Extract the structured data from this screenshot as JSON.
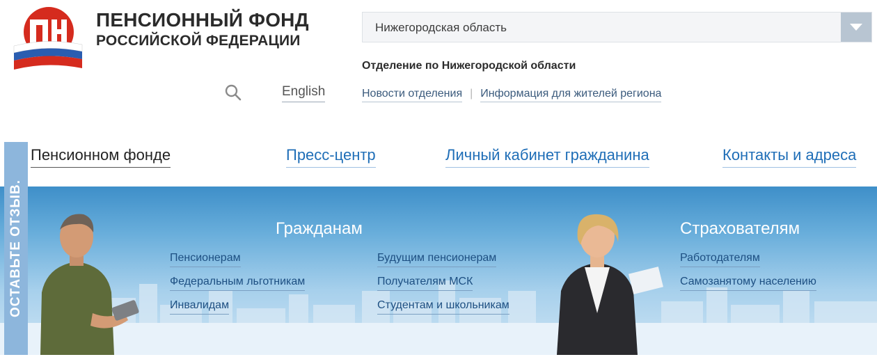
{
  "header": {
    "brand_line1": "ПЕНСИОННЫЙ ФОНД",
    "brand_line2": "РОССИЙСКОЙ ФЕДЕРАЦИИ",
    "region": "Нижегородская область",
    "office": "Отделение по Нижегородской области",
    "lang": "English",
    "sublinks": [
      "Новости отделения",
      "Информация для жителей региона"
    ],
    "sublink_separator": "|"
  },
  "nav": [
    "Пенсионном фонде",
    "Пресс-центр",
    "Личный кабинет гражданина",
    "Контакты и адреса"
  ],
  "feedback": "ОСТАВЬТЕ ОТЗЫВ.",
  "banner": {
    "citizens": {
      "title": "Гражданам",
      "col1": [
        "Пенсионерам",
        "Федеральным льготникам",
        "Инвалидам"
      ],
      "col2": [
        "Будущим пенсионерам",
        "Получателям МСК",
        "Студентам и школьникам"
      ]
    },
    "insurers": {
      "title": "Страхователям",
      "links": [
        "Работодателям",
        "Самозанятому населению"
      ]
    }
  },
  "icons": {
    "logo": "pfr-logo",
    "search": "search-icon",
    "dropdown": "chevron-down-icon"
  },
  "colors": {
    "link_blue": "#1f6eb7",
    "dark_text": "#2b2b2b",
    "banner_sky": "#69aedb",
    "flag_red": "#d52b1e",
    "flag_blue": "#2a5db0"
  }
}
